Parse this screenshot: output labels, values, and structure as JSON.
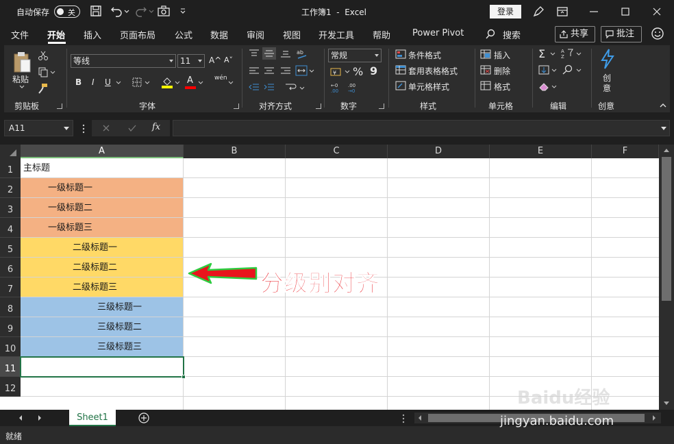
{
  "titlebar": {
    "autosave_label": "自动保存",
    "autosave_state": "关",
    "doc_title": "工作簿1  -  Excel",
    "login_label": "登录"
  },
  "menu": {
    "tabs": [
      "文件",
      "开始",
      "插入",
      "页面布局",
      "公式",
      "数据",
      "审阅",
      "视图",
      "开发工具",
      "帮助",
      "Power Pivot",
      "搜索"
    ],
    "share_label": "共享",
    "comment_label": "批注"
  },
  "ribbon": {
    "clipboard": {
      "paste_label": "粘贴",
      "group_label": "剪贴板"
    },
    "font": {
      "font_name": "等线",
      "font_size": "11",
      "group_label": "字体",
      "bold": "B",
      "italic": "I",
      "underline": "U",
      "grow": "A^",
      "shrink": "A˅",
      "phonetic": "wén",
      "font_color_letter": "A"
    },
    "alignment": {
      "group_label": "对齐方式"
    },
    "number": {
      "format": "常规",
      "group_label": "数字",
      "percent": "%",
      "comma": "9"
    },
    "styles": {
      "conditional": "条件格式",
      "table": "套用表格格式",
      "cell": "单元格样式",
      "group_label": "样式"
    },
    "cells": {
      "insert": "插入",
      "delete": "删除",
      "format": "格式",
      "group_label": "单元格"
    },
    "editing": {
      "group_label": "编辑"
    },
    "ideas": {
      "label_line1": "创",
      "label_line2": "意",
      "group_label": "创意"
    }
  },
  "formula_bar": {
    "name_box": "A11",
    "fx": "fx",
    "content": ""
  },
  "grid": {
    "columns": [
      "A",
      "B",
      "C",
      "D",
      "E",
      "F"
    ],
    "rows": [
      "1",
      "2",
      "3",
      "4",
      "5",
      "6",
      "7",
      "8",
      "9",
      "10",
      "11",
      "12"
    ],
    "cells": [
      {
        "row": 1,
        "text": "主标题",
        "indent": 0,
        "fill": "#ffffff"
      },
      {
        "row": 2,
        "text": "一级标题一",
        "indent": 1,
        "fill": "#f4b183"
      },
      {
        "row": 3,
        "text": "一级标题二",
        "indent": 1,
        "fill": "#f4b183"
      },
      {
        "row": 4,
        "text": "一级标题三",
        "indent": 1,
        "fill": "#f4b183"
      },
      {
        "row": 5,
        "text": "二级标题一",
        "indent": 2,
        "fill": "#ffd966"
      },
      {
        "row": 6,
        "text": "二级标题二",
        "indent": 2,
        "fill": "#ffd966"
      },
      {
        "row": 7,
        "text": "二级标题三",
        "indent": 2,
        "fill": "#ffd966"
      },
      {
        "row": 8,
        "text": "三级标题一",
        "indent": 3,
        "fill": "#9dc3e6"
      },
      {
        "row": 9,
        "text": "三级标题二",
        "indent": 3,
        "fill": "#9dc3e6"
      },
      {
        "row": 10,
        "text": "三级标题三",
        "indent": 3,
        "fill": "#9dc3e6"
      }
    ],
    "selected_cell": "A11",
    "annotation": "分级别对齐"
  },
  "sheets": {
    "tabs": [
      "Sheet1"
    ],
    "active": "Sheet1"
  },
  "status": {
    "text": "就绪",
    "watermark": "jingyan.baidu.com",
    "watermark_logo": "Baidu经验"
  },
  "colors": {
    "accent": "#217346",
    "level1": "#f4b183",
    "level2": "#ffd966",
    "level3": "#9dc3e6",
    "annotation": "#e8141c"
  }
}
